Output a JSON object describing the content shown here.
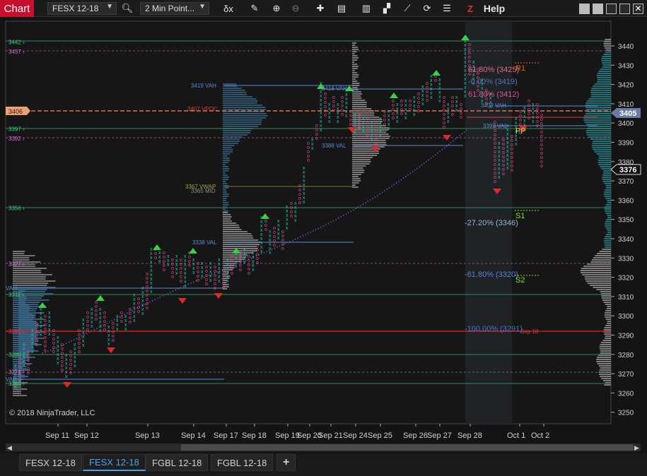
{
  "window": {
    "title": "Chart",
    "help": "Help",
    "z_label": "Z"
  },
  "toolbar": {
    "instrument": "FESX 12-18",
    "bar_type": "2 Min Point..."
  },
  "chart": {
    "copyright": "© 2018 NinjaTrader, LLC",
    "price_ticks": [
      "3440",
      "3430",
      "3420",
      "3410",
      "3400",
      "3390",
      "3380",
      "3370",
      "3360",
      "3350",
      "3340",
      "3330",
      "3320",
      "3310",
      "3300",
      "3290",
      "3280",
      "3270",
      "3260",
      "3250"
    ],
    "current_price": "3405",
    "marker_price": "3376",
    "left_flag": "3406",
    "left_labels": [
      "3442",
      "3437",
      "3397",
      "3392",
      "3356",
      "3327",
      "3311",
      "3292",
      "3280",
      "3271",
      "3265"
    ],
    "x_labels": [
      "Sep 11",
      "Sep 12",
      "Sep 13",
      "Sep 14",
      "Sep 17",
      "Sep 18",
      "Sep 19",
      "Sep 20",
      "Sep 21",
      "Sep 24",
      "Sep 25",
      "Sep 26",
      "Sep 27",
      "Sep 28",
      "Oct 1",
      "Oct 2"
    ],
    "annotations": {
      "vah1": "3419 VAH",
      "vah2": "3418 VAH",
      "vpoc": "3407 VPOC",
      "val1": "3388 VAL",
      "val2": "3338 VAL",
      "vwap": "3367 VWAP",
      "mid": "3365 MID",
      "vah3": "3409 VAH",
      "val3": "3398 VAL",
      "left_vah": "VAH",
      "left_val": "VAL",
      "fib1": "61.80% (3425)",
      "fib2": "-0.00% (3419)",
      "fib3": "61.80% (3412)",
      "fib4": "-27.20% (3346)",
      "fib5": "-61.80% (3320)",
      "fib6": "-100.00% (3291)",
      "r1": "R1",
      "pp": "PP",
      "s1": "S1",
      "s2": "S2",
      "sep18_label": "Sep 18"
    }
  },
  "tabs": [
    "FESX 12-18",
    "FESX 12-18",
    "FGBL 12-18",
    "FGBL 12-18"
  ],
  "colors": {
    "up": "#23c4a8",
    "down": "#e0508e",
    "bg": "#141414",
    "grid": "#2c2c2c",
    "accent": "#4aa3e8",
    "sell": "#e02828",
    "buy": "#3ad04a",
    "vwap": "#7060e0"
  }
}
